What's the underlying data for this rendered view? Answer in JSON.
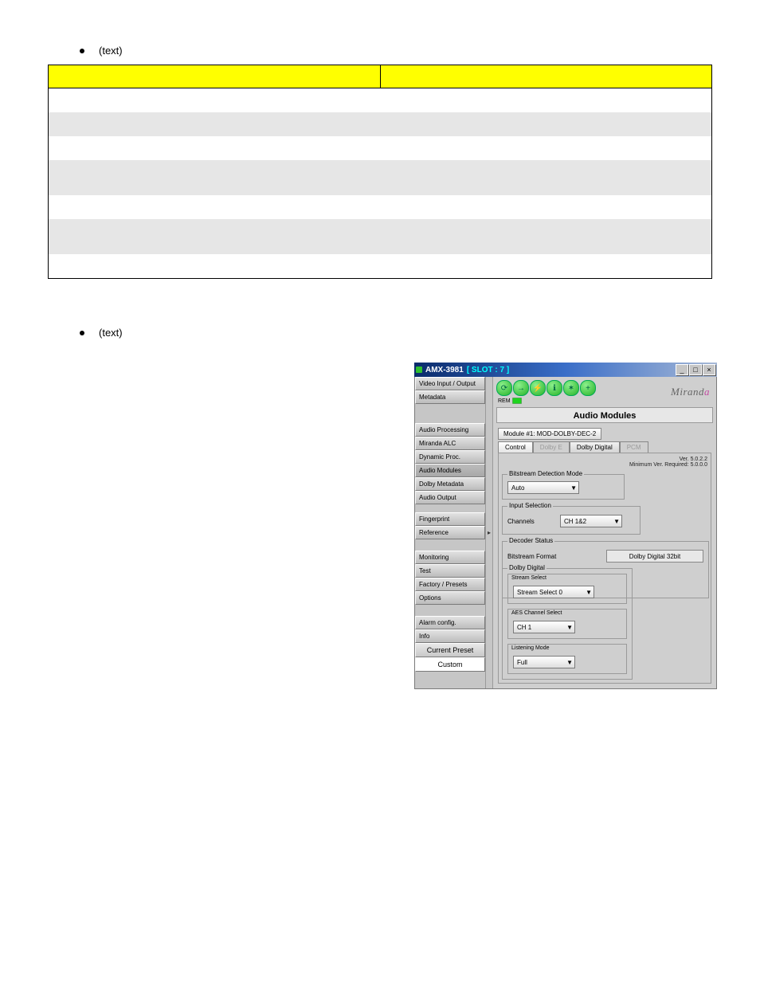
{
  "bullets": {
    "bullet1": "(text)",
    "bullet2": "(text)"
  },
  "table": {
    "rows": [
      {
        "c1": "",
        "c2": ""
      },
      {
        "c1": "",
        "c2": ""
      },
      {
        "c1": "",
        "c2": ""
      },
      {
        "c1": "",
        "c2": ""
      },
      {
        "c1": "",
        "c2": ""
      },
      {
        "c1": "",
        "c2": ""
      },
      {
        "c1": "",
        "c2": ""
      }
    ]
  },
  "window": {
    "title_prefix": "AMX-3981",
    "title_slot": "[ SLOT : 7 ]",
    "brand": "Miranda",
    "rem_label": "REM",
    "panel_title": "Audio Modules",
    "module_label": "Module #1: MOD-DOLBY-DEC-2",
    "tabs": {
      "control": "Control",
      "dolbye": "Dolby E",
      "dolbydigital": "Dolby Digital",
      "pcm": "PCM"
    },
    "version_line1": "Ver. 5.0.2.2",
    "version_line2": "Minimum Ver. Required: 5.0.0.0",
    "bitstream_group": "Bitstream Detection Mode",
    "bitstream_value": "Auto",
    "input_group": "Input Selection",
    "channels_label": "Channels",
    "channels_value": "CH 1&2",
    "decoder_group": "Decoder Status",
    "bitformat_label": "Bitstream Format",
    "bitformat_value": "Dolby Digital 32bit",
    "dolby_group": "Dolby Digital",
    "stream_select_label": "Stream Select",
    "stream_select_value": "Stream Select 0",
    "aes_label": "AES Channel Select",
    "aes_value": "CH 1",
    "listening_label": "Listening Mode",
    "listening_value": "Full"
  },
  "sidebar": {
    "items": [
      "Video Input / Output",
      "Metadata",
      "Audio Processing",
      "Miranda ALC",
      "Dynamic Proc.",
      "Audio Modules",
      "Dolby Metadata",
      "Audio Output",
      "Fingerprint",
      "Reference",
      "Monitoring",
      "Test",
      "Factory / Presets",
      "Options",
      "Alarm config.",
      "Info"
    ],
    "current_preset_label": "Current Preset",
    "current_preset_value": "Custom"
  }
}
